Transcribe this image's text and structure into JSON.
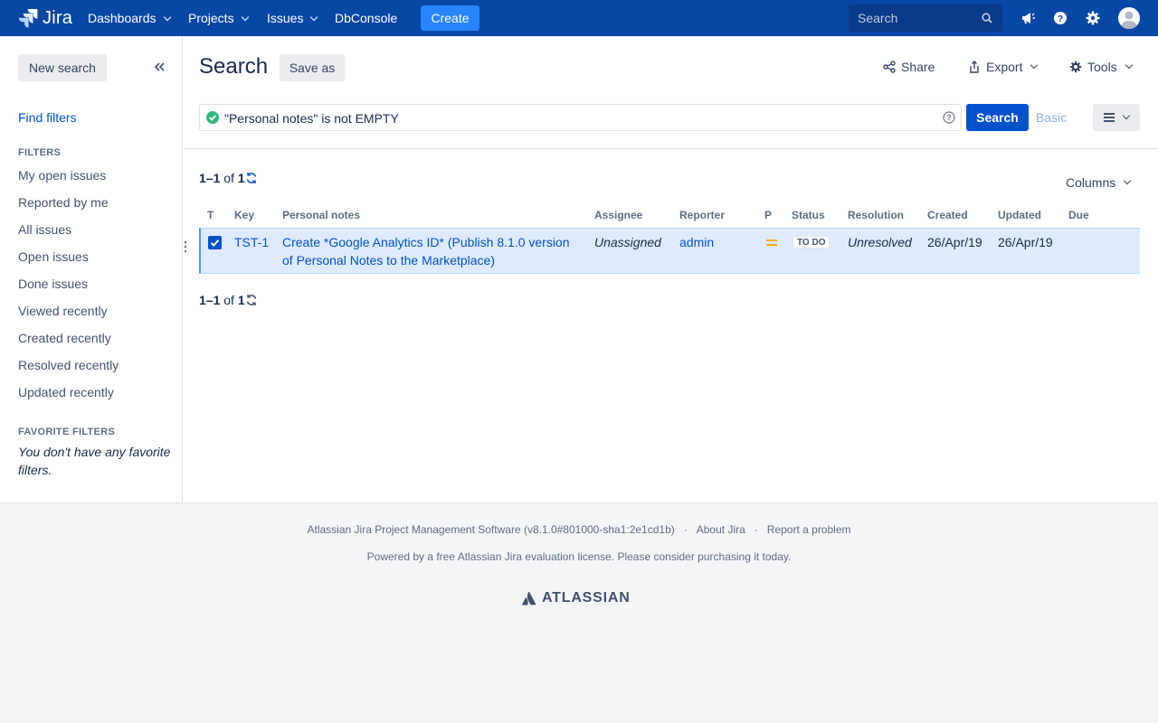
{
  "topnav": {
    "logo": "Jira",
    "items": [
      {
        "label": "Dashboards",
        "dropdown": true
      },
      {
        "label": "Projects",
        "dropdown": true
      },
      {
        "label": "Issues",
        "dropdown": true
      },
      {
        "label": "DbConsole",
        "dropdown": false
      }
    ],
    "create_label": "Create",
    "search_placeholder": "Search",
    "icons": [
      "megaphone-icon",
      "help-icon",
      "gear-icon",
      "avatar"
    ]
  },
  "sidebar": {
    "new_search_label": "New search",
    "find_filters_label": "Find filters",
    "filters_heading": "FILTERS",
    "filters": [
      "My open issues",
      "Reported by me",
      "All issues",
      "Open issues",
      "Done issues",
      "Viewed recently",
      "Created recently",
      "Resolved recently",
      "Updated recently"
    ],
    "favorite_heading": "FAVORITE FILTERS",
    "favorite_empty": "You don't have any favorite filters."
  },
  "main": {
    "title": "Search",
    "save_as_label": "Save as",
    "share_label": "Share",
    "export_label": "Export",
    "tools_label": "Tools",
    "jql_query": "\"Personal notes\" is not EMPTY",
    "search_button_label": "Search",
    "basic_label": "Basic",
    "count_range": "1–1",
    "count_of": "of",
    "count_total": "1",
    "columns_label": "Columns",
    "table": {
      "headers": [
        "T",
        "Key",
        "Personal notes",
        "Assignee",
        "Reporter",
        "P",
        "Status",
        "Resolution",
        "Created",
        "Updated",
        "Due"
      ],
      "rows": [
        {
          "key": "TST-1",
          "personal_notes_line1": "Create *Google Analytics ID* (Publish 8.1.0 version",
          "personal_notes_line2": "of Personal Notes to the Marketplace)",
          "assignee": "Unassigned",
          "reporter": "admin",
          "priority": "Medium",
          "status": "TO DO",
          "resolution": "Unresolved",
          "created": "26/Apr/19",
          "updated": "26/Apr/19",
          "due": ""
        }
      ]
    }
  },
  "footer": {
    "software": "Atlassian Jira Project Management Software (v8.1.0#801000-sha1:2e1cd1b)",
    "about": "About Jira",
    "report": "Report a problem",
    "license": "Powered by a free Atlassian Jira evaluation license. Please consider purchasing it today.",
    "brand": "ATLASSIAN"
  },
  "colors": {
    "nav_bg": "#0747a6",
    "create_bg": "#2684ff",
    "primary": "#0052cc",
    "selected_row": "#deebff",
    "priority_medium": "#ffab00"
  }
}
